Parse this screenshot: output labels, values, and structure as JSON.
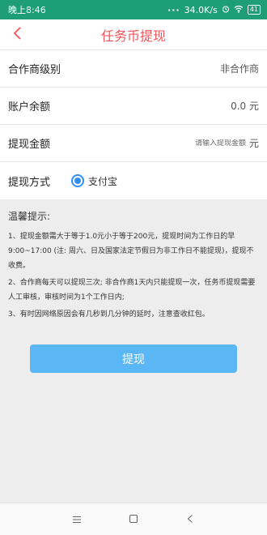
{
  "status_bar": {
    "time": "晚上8:46",
    "dots": "···",
    "speed": "34.0K/s",
    "battery": "41"
  },
  "header": {
    "title": "任务币提现",
    "back_icon": "chevron-left-icon",
    "accent_color": "#f2545b"
  },
  "form": {
    "level": {
      "label": "合作商级别",
      "value": "非合作商"
    },
    "balance": {
      "label": "账户余额",
      "value": "0.0 元"
    },
    "amount": {
      "label": "提现金额",
      "placeholder": "请输入提现金额",
      "unit": "元"
    },
    "method": {
      "label": "提现方式",
      "option": "支付宝",
      "selected": true
    }
  },
  "tips": {
    "title": "温馨提示:",
    "items": [
      "1、提现金额需大于等于1.0元小于等于200元，提现时间为工作日的早9:00~17:00 (注: 周六、日及国家法定节假日为非工作日不能提现)，提现不收费。",
      "2、合作商每天可以提现三次; 非合作商1天内只能提现一次，任务币提现需要人工审核，审核时间为1个工作日内;",
      "3、有时因网络原因会有几秒到几分钟的延时，注意查收红包。"
    ]
  },
  "submit": {
    "label": "提现",
    "color": "#5ab6f4"
  },
  "system_nav": {
    "menu_icon": "menu-icon",
    "home_icon": "home-square-icon",
    "back_icon": "back-triangle-icon"
  }
}
